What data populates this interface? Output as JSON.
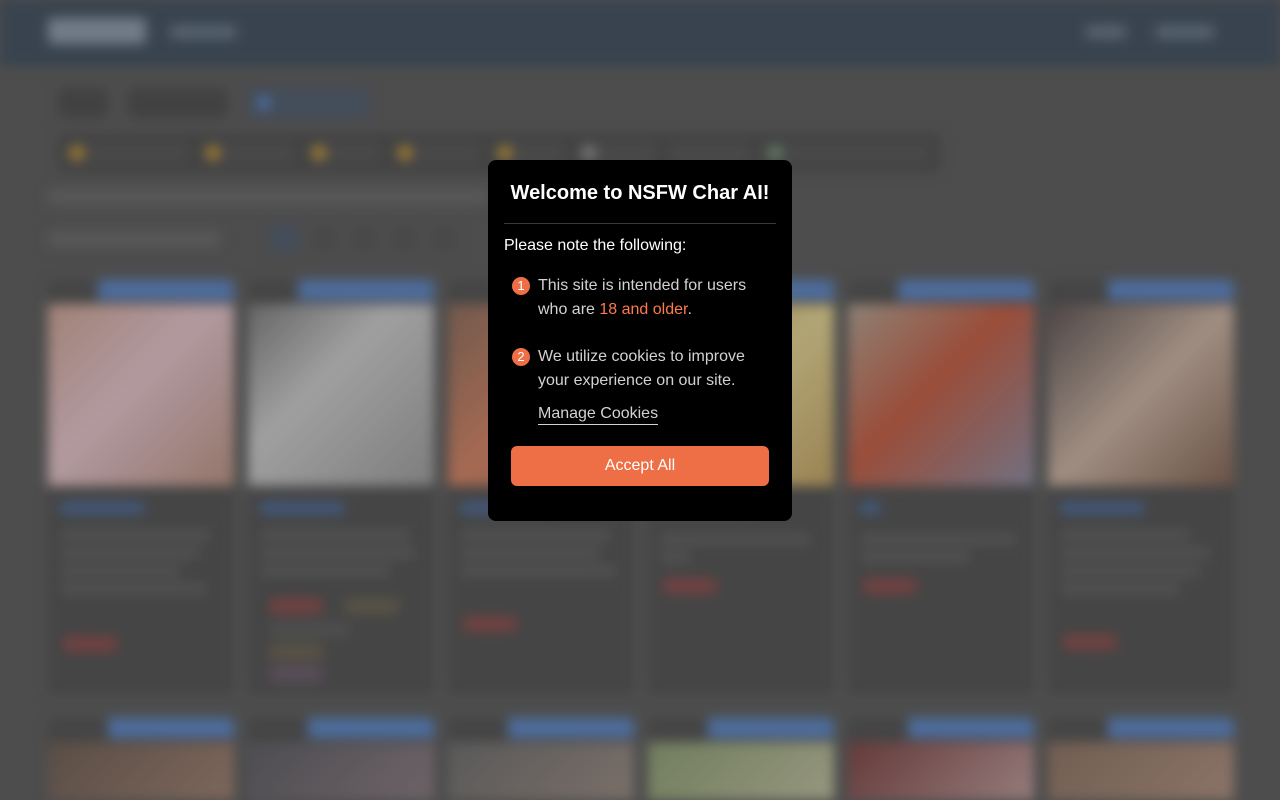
{
  "modal": {
    "title": "Welcome to NSFW Char AI!",
    "lead": "Please note the following:",
    "items": [
      {
        "num": "1",
        "text_before": "This site is intended for users who are ",
        "highlight": "18 and older",
        "text_after": "."
      },
      {
        "num": "2",
        "text": "We utilize cookies to improve your experience on our site."
      }
    ],
    "manage_label": "Manage Cookies",
    "accept_label": "Accept All"
  },
  "colors": {
    "accent": "#ee6e45",
    "highlight": "#ff7a4c",
    "modal_bg": "#000000",
    "header_bg": "#3e4d5c",
    "badge_blue": "#5a84c4"
  },
  "background": {
    "cards_row1": 6,
    "cards_row2": 6
  }
}
